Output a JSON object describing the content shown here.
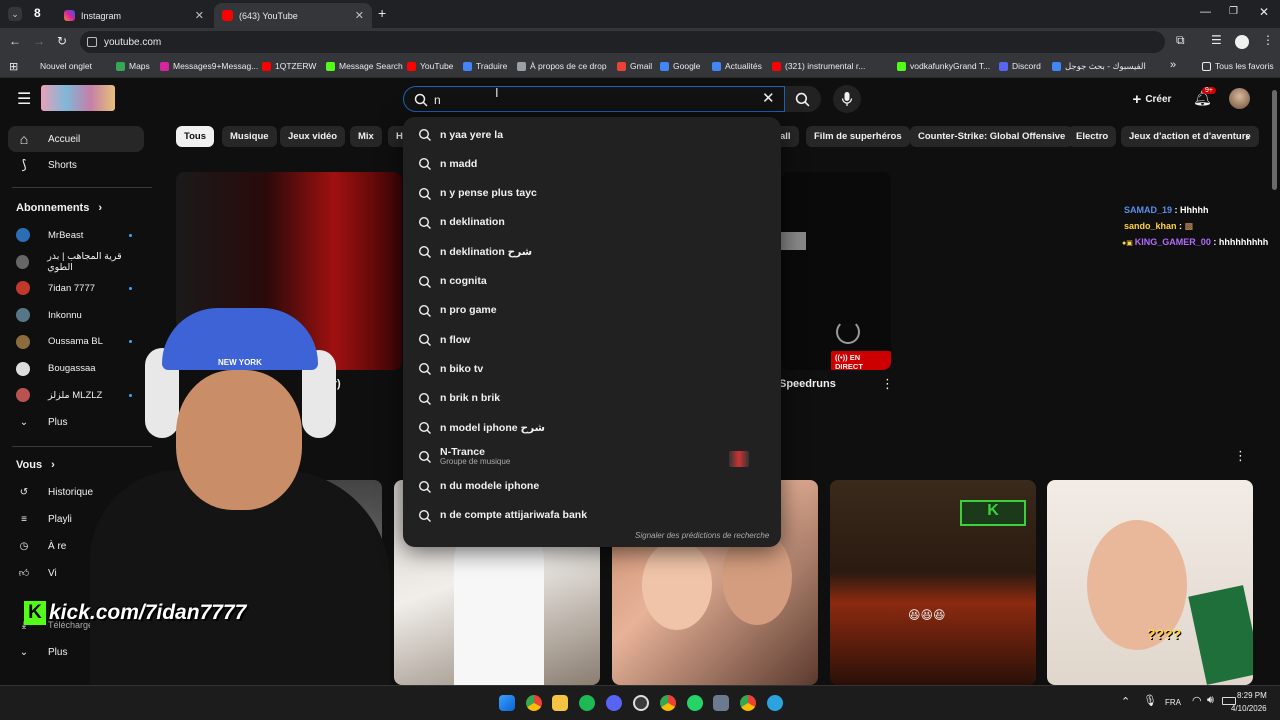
{
  "browser": {
    "tabs": [
      {
        "label": "Instagram",
        "color": "#d6249f"
      },
      {
        "label": "(643) YouTube",
        "color": "#ff0000"
      }
    ],
    "new_tab": "+",
    "url": "youtube.com",
    "bookmarks": [
      {
        "label": "Nouvel onglet",
        "color": "#9aa0a6"
      },
      {
        "label": "Maps",
        "color": "#34a853"
      },
      {
        "label": "Messages9+Messag...",
        "color": "#d6249f"
      },
      {
        "label": "1QTZERW",
        "color": "#ff0000"
      },
      {
        "label": "Message Search",
        "color": "#53fc18"
      },
      {
        "label": "YouTube",
        "color": "#ff0000"
      },
      {
        "label": "Traduire",
        "color": "#4285f4"
      },
      {
        "label": "À propos de ce drop",
        "color": "#9aa0a6"
      },
      {
        "label": "Gmail",
        "color": "#ea4335"
      },
      {
        "label": "Google",
        "color": "#4285f4"
      },
      {
        "label": "Actualités",
        "color": "#4285f4"
      },
      {
        "label": "(321) instrumental r...",
        "color": "#ff0000"
      },
      {
        "label": "vodkafunkyGrand T...",
        "color": "#53fc18"
      },
      {
        "label": "Discord",
        "color": "#5865f2"
      },
      {
        "label": "الفيسبوك - بحث جوجل",
        "color": "#4285f4"
      }
    ],
    "bookmarks_more": "»",
    "all_bookmarks": "Tous les favoris"
  },
  "header": {
    "search_value": "n",
    "create_label": "Créer",
    "notif_badge": "9+"
  },
  "sidebar": {
    "main": [
      {
        "label": "Accueil"
      },
      {
        "label": "Shorts"
      }
    ],
    "subs_heading": "Abonnements",
    "subs": [
      {
        "label": "MrBeast",
        "color": "#2a6fb5",
        "dot": true
      },
      {
        "label": "قرية المجاهب | بدر الطوي",
        "color": "#666666",
        "dot": false
      },
      {
        "label": "7idan 7777",
        "color": "#c0392b",
        "dot": true
      },
      {
        "label": "Inkonnu",
        "color": "#557788",
        "dot": false
      },
      {
        "label": "Oussama BL",
        "color": "#8a6d3b",
        "dot": true
      },
      {
        "label": "Bougassaa",
        "color": "#dddddd",
        "dot": false
      },
      {
        "label": "ملزلز MLZLZ",
        "color": "#b9534f",
        "dot": true
      }
    ],
    "subs_more": "Plus",
    "you_heading": "Vous",
    "you": [
      {
        "label": "Historique"
      },
      {
        "label": "Playli"
      },
      {
        "label": "À re"
      },
      {
        "label": "Vi"
      },
      {
        "label": "Téléchargements"
      }
    ],
    "you_more": "Plus"
  },
  "chips": [
    "Tous",
    "Musique",
    "Jeux vidéo",
    "Mix",
    "H",
    "all",
    "Film de superhéros",
    "Counter-Strike: Global Offensive",
    "Electro",
    "Jeux d'action et d'aventure"
  ],
  "suggestions": [
    {
      "text": "n yaa yere la"
    },
    {
      "text": "n madd"
    },
    {
      "text": "n y pense plus tayc"
    },
    {
      "text": "n deklination"
    },
    {
      "text": "n deklination شرح"
    },
    {
      "text": "n cognita"
    },
    {
      "text": "n pro game"
    },
    {
      "text": "n flow"
    },
    {
      "text": "n biko tv"
    },
    {
      "text": "n brik n brik"
    },
    {
      "text": "n model iphone شرح"
    },
    {
      "text": "N-Trance",
      "sub": "Groupe de musique"
    },
    {
      "text": "n du modele iphone"
    },
    {
      "text": "n de compte attijariwafa bank"
    }
  ],
  "suggest_footer": "Signaler des prédictions de recherche",
  "videos": {
    "title_fragment_1": "izer)",
    "title_fragment_2": "Speedruns",
    "live_badge": "EN DIRECT",
    "thumb_overlay": "????"
  },
  "chat": [
    {
      "user": "SAMAD_19",
      "msg": "Hhhhh",
      "color": "#5b8def"
    },
    {
      "user": "sando_khan",
      "msg": "",
      "color": "#ffd23f"
    },
    {
      "user": "KING_GAMER_00",
      "msg": "hhhhhhhhh",
      "color": "#b36bff"
    }
  ],
  "overlay": {
    "kick_url": "kick.com/7idan7777",
    "cap_text": "NEW YORK"
  },
  "taskbar": {
    "lang": "FRA",
    "time": "8:29 PM",
    "date": "4/10/2026"
  }
}
